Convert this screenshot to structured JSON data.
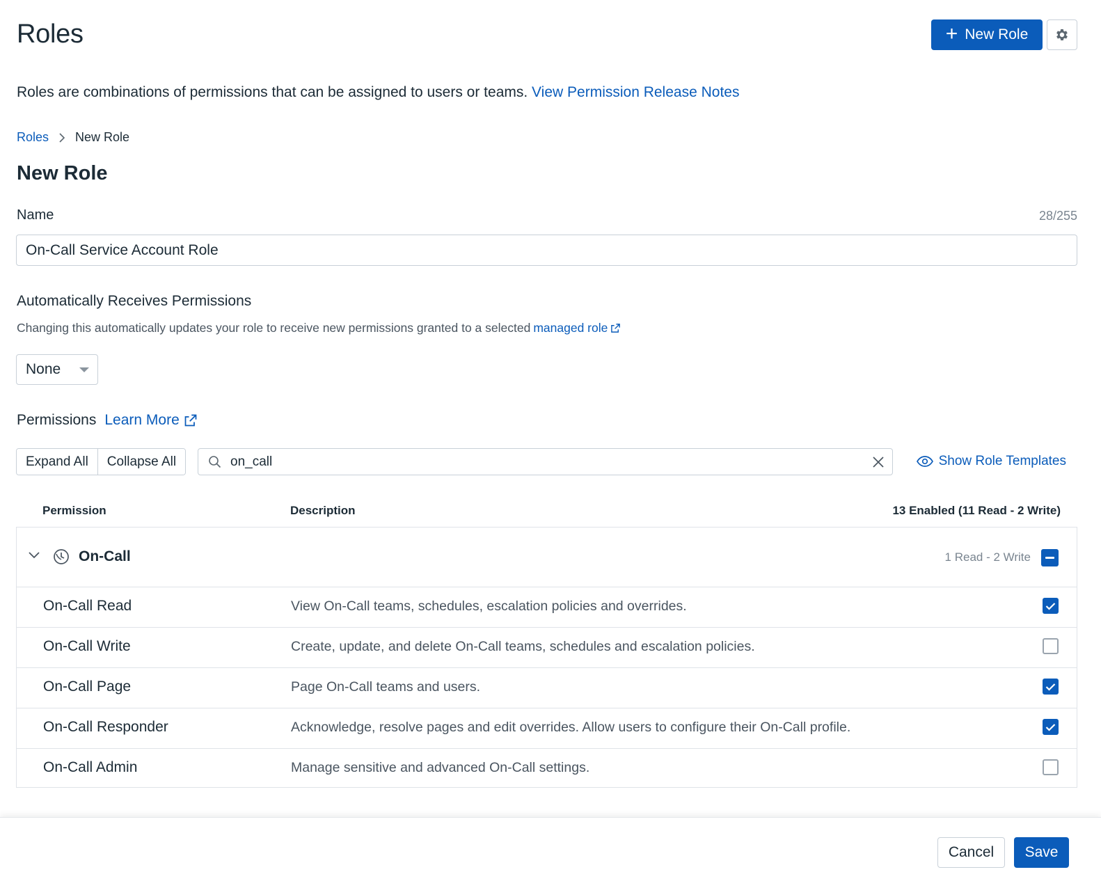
{
  "page": {
    "title": "Roles",
    "new_role_button": "New Role",
    "intro_text": "Roles are combinations of permissions that can be assigned to users or teams.",
    "intro_link": "View Permission Release Notes"
  },
  "breadcrumb": {
    "root": "Roles",
    "separator": ">",
    "current": "New Role"
  },
  "form": {
    "section_title": "New Role",
    "name_label": "Name",
    "name_counter": "28/255",
    "name_value": "On-Call Service Account Role",
    "auto_label": "Automatically Receives Permissions",
    "auto_help": "Changing this automatically updates your role to receive new permissions granted to a selected",
    "auto_help_link": "managed role",
    "auto_select_value": "None"
  },
  "permissions": {
    "label": "Permissions",
    "learn_more": "Learn More",
    "expand_all": "Expand All",
    "collapse_all": "Collapse All",
    "search_value": "on_call",
    "show_templates": "Show Role Templates",
    "columns": {
      "permission": "Permission",
      "description": "Description",
      "enabled_summary": "13 Enabled (11 Read - 2 Write)"
    },
    "group": {
      "name": "On-Call",
      "count": "1 Read - 2 Write",
      "state": "indeterminate"
    },
    "rows": [
      {
        "name": "On-Call Read",
        "description": "View On-Call teams, schedules, escalation policies and overrides.",
        "checked": true
      },
      {
        "name": "On-Call Write",
        "description": "Create, update, and delete On-Call teams, schedules and escalation policies.",
        "checked": false
      },
      {
        "name": "On-Call Page",
        "description": "Page On-Call teams and users.",
        "checked": true
      },
      {
        "name": "On-Call Responder",
        "description": "Acknowledge, resolve pages and edit overrides. Allow users to configure their On-Call profile.",
        "checked": true
      },
      {
        "name": "On-Call Admin",
        "description": "Manage sensitive and advanced On-Call settings.",
        "checked": false
      }
    ]
  },
  "footer": {
    "cancel": "Cancel",
    "save": "Save"
  },
  "colors": {
    "accent": "#0b5cba",
    "text": "#1c2b36",
    "muted": "#7a8590",
    "border": "#c8d0d8"
  }
}
